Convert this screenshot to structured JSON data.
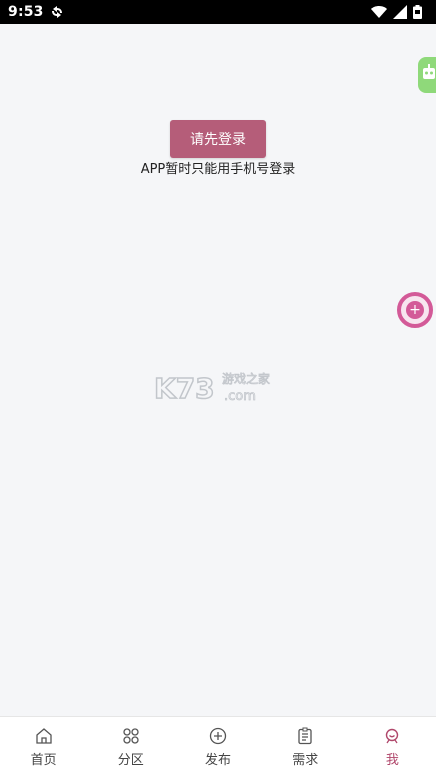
{
  "status_bar": {
    "time": "9:53"
  },
  "main": {
    "login_button_label": "请先登录",
    "login_hint": "APP暂时只能用手机号登录",
    "watermark": {
      "main": "K73",
      "top_right": "游戏之家",
      "bottom_right": ".com"
    },
    "float_add_symbol": "+"
  },
  "bottom_nav": {
    "items": [
      {
        "label": "首页",
        "icon": "home-icon"
      },
      {
        "label": "分区",
        "icon": "grid-icon"
      },
      {
        "label": "发布",
        "icon": "add-circle-icon"
      },
      {
        "label": "需求",
        "icon": "clipboard-icon"
      },
      {
        "label": "我",
        "icon": "user-icon"
      }
    ],
    "active_index": 4
  },
  "colors": {
    "accent": "#b55d79",
    "active_tab": "#b0476b",
    "float_button": "#d35a98",
    "side_widget": "#8fd97a",
    "background": "#f5f6f8"
  }
}
